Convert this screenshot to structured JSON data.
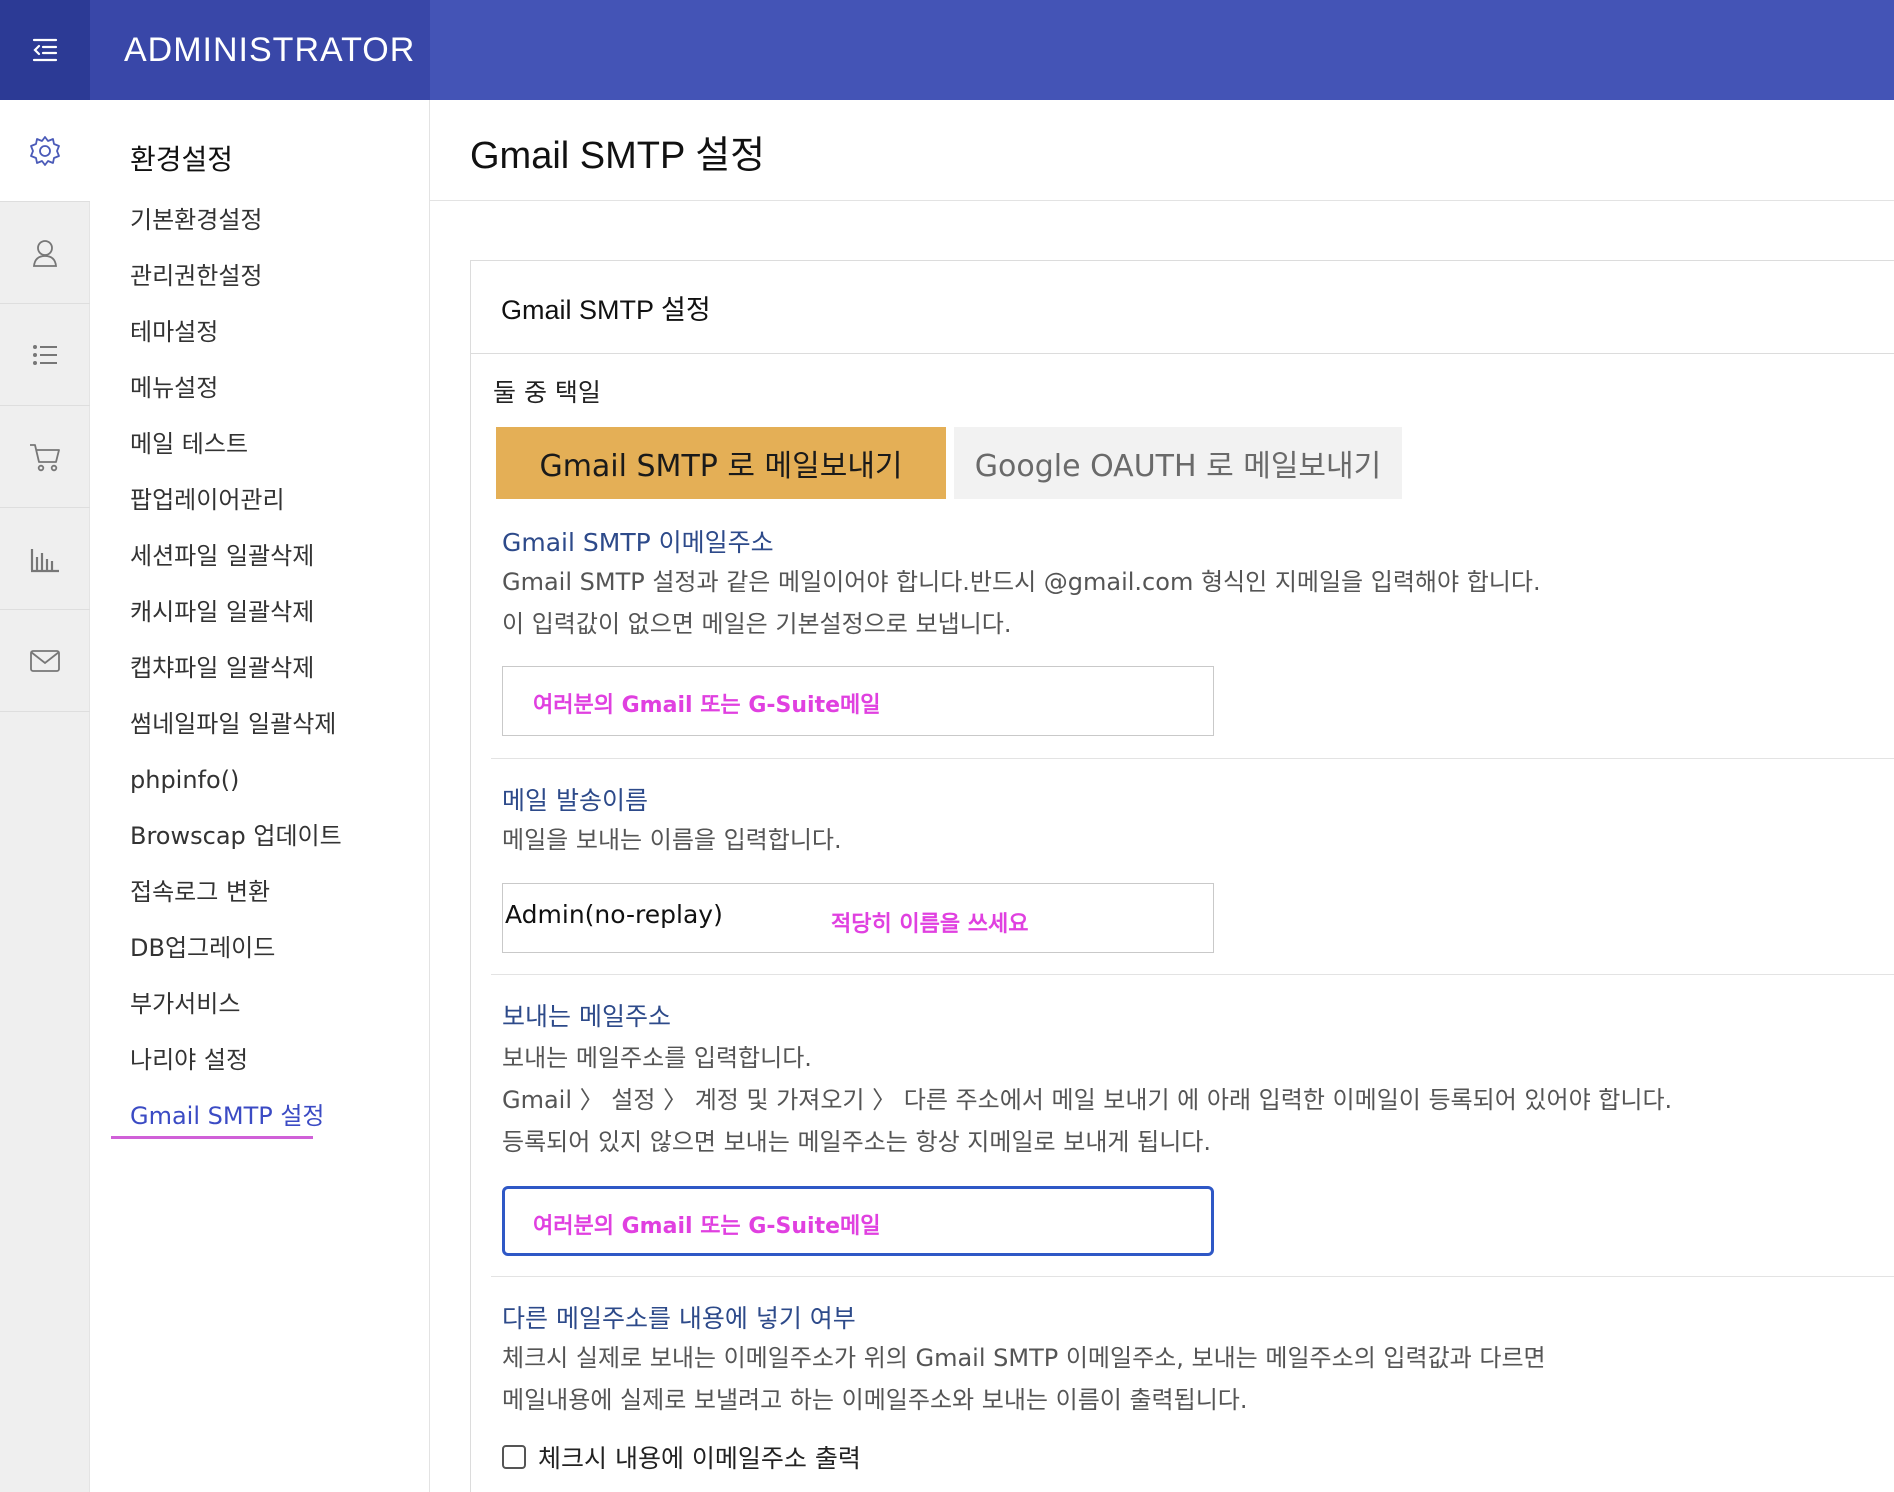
{
  "app": {
    "brand": "ADMINISTRATOR"
  },
  "rail": {
    "items": [
      {
        "icon": "gear-icon",
        "active": true
      },
      {
        "icon": "user-icon"
      },
      {
        "icon": "list-icon"
      },
      {
        "icon": "cart-icon"
      },
      {
        "icon": "chart-icon"
      },
      {
        "icon": "mail-icon"
      }
    ]
  },
  "submenu": {
    "title": "환경설정",
    "items": [
      "기본환경설정",
      "관리권한설정",
      "테마설정",
      "메뉴설정",
      "메일 테스트",
      "팝업레이어관리",
      "세션파일 일괄삭제",
      "캐시파일 일괄삭제",
      "캡챠파일 일괄삭제",
      "썸네일파일 일괄삭제",
      "phpinfo()",
      "Browscap 업데이트",
      "접속로그 변환",
      "DB업그레이드",
      "부가서비스",
      "나리야 설정",
      "Gmail SMTP 설정"
    ]
  },
  "main": {
    "page_title": "Gmail SMTP 설정",
    "panel_title": "Gmail SMTP 설정",
    "choose_label": "둘 중 택일",
    "option_smtp": "Gmail SMTP 로 메일보내기",
    "option_oauth": "Google OAUTH 로 메일보내기",
    "email": {
      "title": "Gmail SMTP 이메일주소",
      "desc1": "Gmail SMTP 설정과 같은 메일이어야 합니다.반드시 @gmail.com 형식인 지메일을 입력해야 합니다.",
      "desc2": "이 입력값이 없으면 메일은 기본설정으로 보냅니다.",
      "hint": "여러분의 Gmail 또는 G-Suite메일"
    },
    "sender_name": {
      "title": "메일 발송이름",
      "desc": "메일을 보내는 이름을 입력합니다.",
      "value": "Admin(no-replay)",
      "hint": "적당히 이름을 쓰세요"
    },
    "sender_email": {
      "title": "보내는 메일주소",
      "desc1": "보내는 메일주소를 입력합니다.",
      "desc2": "Gmail 〉 설정 〉 계정 및 가져오기 〉 다른 주소에서 메일 보내기 에 아래 입력한 이메일이 등록되어 있어야 합니다.",
      "desc3": "등록되어 있지 않으면 보내는 메일주소는 항상 지메일로 보내게 됩니다.",
      "hint": "여러분의 Gmail 또는 G-Suite메일"
    },
    "include_other": {
      "title": "다른 메일주소를 내용에 넣기 여부",
      "desc1": "체크시 실제로 보내는 이메일주소가 위의 Gmail SMTP 이메일주소, 보내는 메일주소의 입력값과 다르면",
      "desc2": "메일내용에 실제로 보낼려고 하는 이메일주소와 보내는 이름이 출력됩니다.",
      "checkbox_label": "체크시 내용에 이메일주소 출력"
    }
  },
  "colors": {
    "topbar": "#4454b6",
    "accent": "#e4af56",
    "active_link": "#3b4bc4",
    "hint": "#e040e0"
  }
}
